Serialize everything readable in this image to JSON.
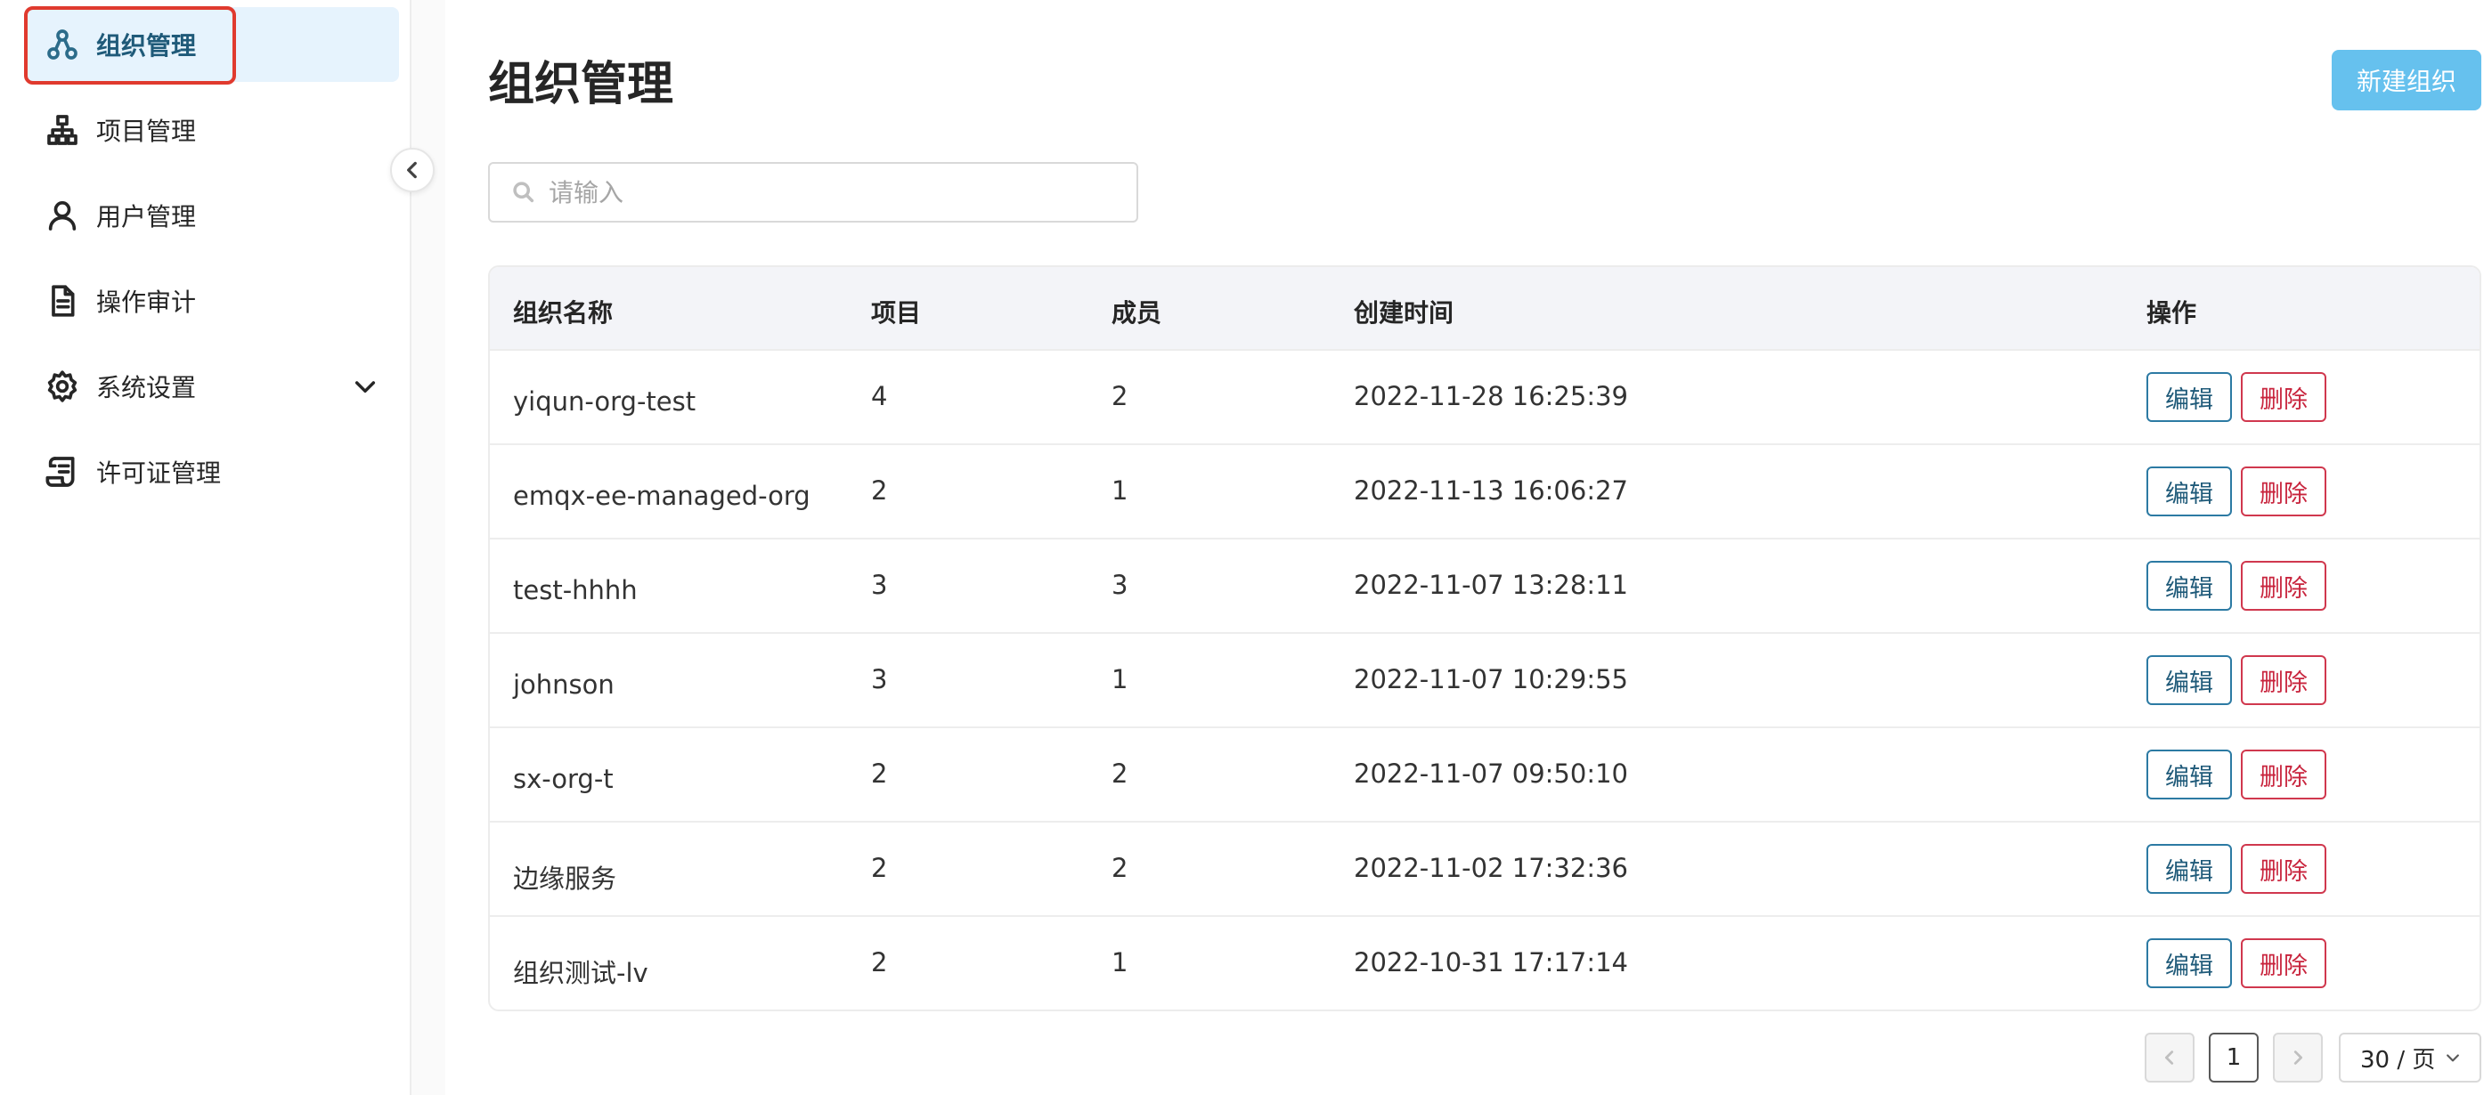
{
  "sidebar": {
    "items": [
      {
        "label": "组织管理",
        "icon": "organization-icon",
        "active": true
      },
      {
        "label": "项目管理",
        "icon": "hierarchy-icon"
      },
      {
        "label": "用户管理",
        "icon": "user-icon"
      },
      {
        "label": "操作审计",
        "icon": "document-icon"
      },
      {
        "label": "系统设置",
        "icon": "gear-icon",
        "expandable": true
      },
      {
        "label": "许可证管理",
        "icon": "license-icon"
      }
    ],
    "highlight_color": "#e03a2e"
  },
  "main": {
    "title": "组织管理",
    "new_button_label": "新建组织",
    "search": {
      "placeholder": "请输入",
      "value": ""
    },
    "table": {
      "headers": [
        "组织名称",
        "项目",
        "成员",
        "创建时间",
        "操作"
      ],
      "rows": [
        {
          "name": "yiqun-org-test",
          "projects": "4",
          "members": "2",
          "created": "2022-11-28 16:25:39"
        },
        {
          "name": "emqx-ee-managed-org",
          "projects": "2",
          "members": "1",
          "created": "2022-11-13 16:06:27"
        },
        {
          "name": "test-hhhh",
          "projects": "3",
          "members": "3",
          "created": "2022-11-07 13:28:11"
        },
        {
          "name": "johnson",
          "projects": "3",
          "members": "1",
          "created": "2022-11-07 10:29:55"
        },
        {
          "name": "sx-org-t",
          "projects": "2",
          "members": "2",
          "created": "2022-11-07 09:50:10"
        },
        {
          "name": "边缘服务",
          "projects": "2",
          "members": "2",
          "created": "2022-11-02 17:32:36"
        },
        {
          "name": "组织测试-lv",
          "projects": "2",
          "members": "1",
          "created": "2022-10-31 17:17:14"
        }
      ],
      "edit_label": "编辑",
      "delete_label": "删除"
    },
    "pagination": {
      "current_page": "1",
      "page_size": "30 / 页"
    }
  },
  "colors": {
    "accent": "#66c1ee",
    "edit": "#2c7aa3",
    "delete": "#d0384e",
    "active_bg": "#e6f3fd"
  }
}
